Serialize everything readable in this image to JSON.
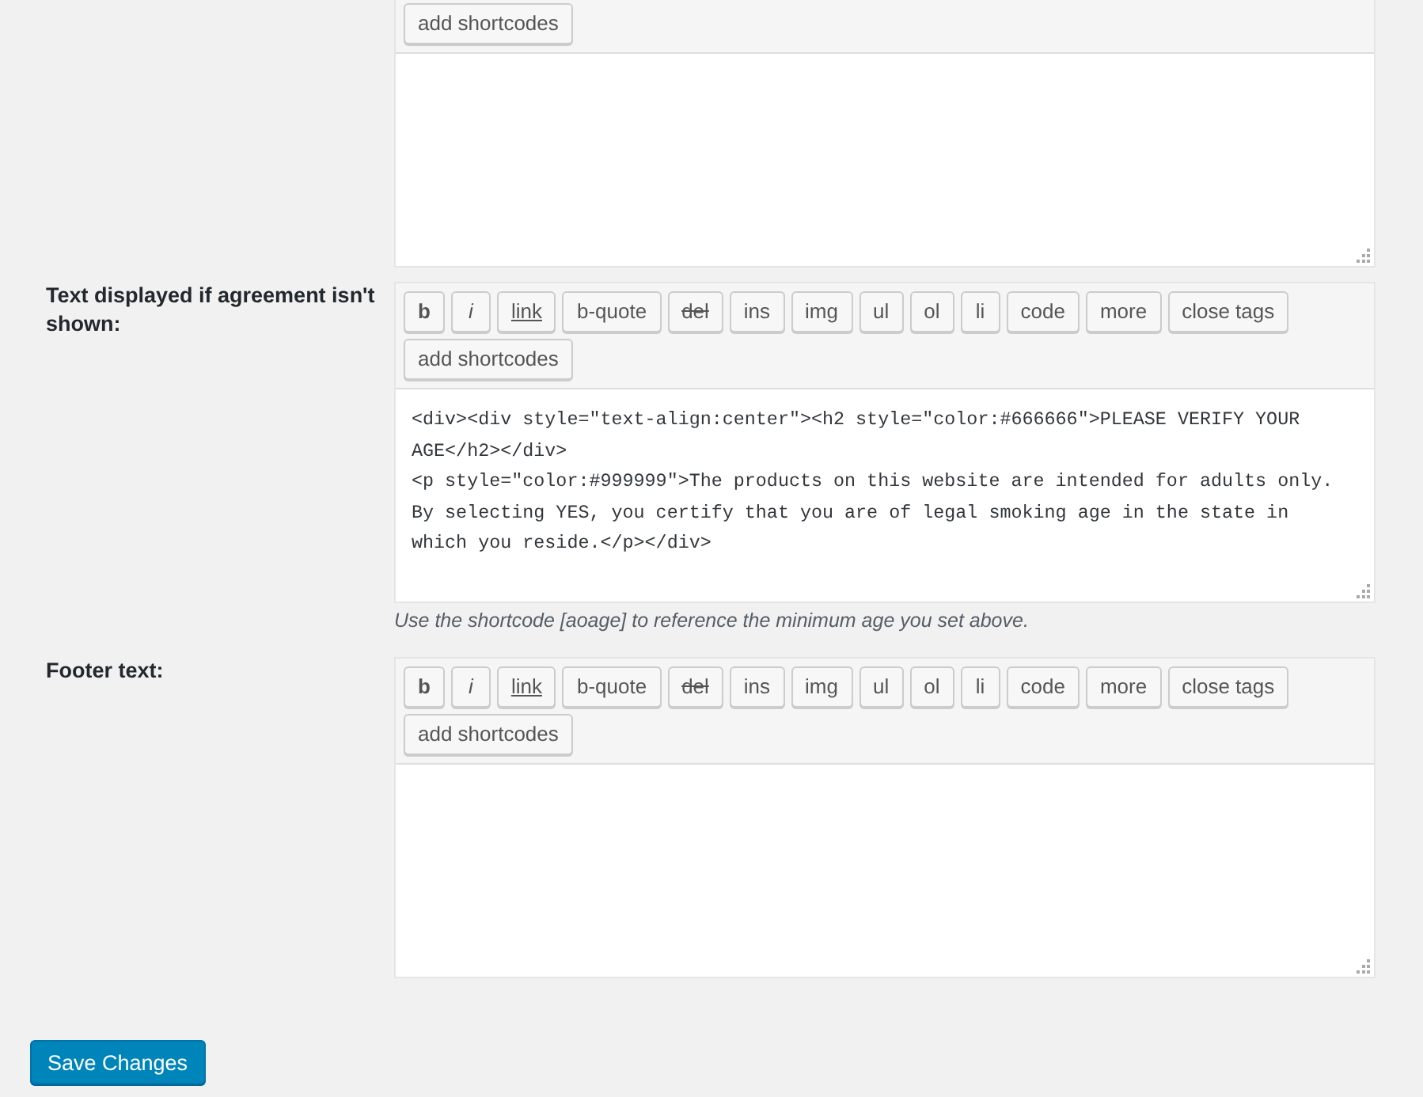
{
  "fields": [
    {
      "buttons": [
        {
          "label": "add shortcodes",
          "kind": "plain"
        }
      ]
    },
    {
      "label": "Text displayed if agreement isn't shown:",
      "buttons": [
        {
          "label": "b",
          "kind": "bold"
        },
        {
          "label": "i",
          "kind": "italic"
        },
        {
          "label": "link",
          "kind": "underline"
        },
        {
          "label": "b-quote",
          "kind": "plain"
        },
        {
          "label": "del",
          "kind": "strike"
        },
        {
          "label": "ins",
          "kind": "plain"
        },
        {
          "label": "img",
          "kind": "plain"
        },
        {
          "label": "ul",
          "kind": "plain"
        },
        {
          "label": "ol",
          "kind": "plain"
        },
        {
          "label": "li",
          "kind": "plain"
        },
        {
          "label": "code",
          "kind": "plain"
        },
        {
          "label": "more",
          "kind": "plain"
        },
        {
          "label": "close tags",
          "kind": "plain"
        },
        {
          "label": "add shortcodes",
          "kind": "plain"
        }
      ],
      "value": "<div><div style=\"text-align:center\"><h2 style=\"color:#666666\">PLEASE VERIFY YOUR AGE</h2></div>\n<p style=\"color:#999999\">The products on this website are intended for adults only. By selecting YES, you certify that you are of legal smoking age in the state in which you reside.</p></div>",
      "hint": "Use the shortcode [aoage] to reference the minimum age you set above."
    },
    {
      "label": "Footer text:",
      "buttons": [
        {
          "label": "b",
          "kind": "bold"
        },
        {
          "label": "i",
          "kind": "italic"
        },
        {
          "label": "link",
          "kind": "underline"
        },
        {
          "label": "b-quote",
          "kind": "plain"
        },
        {
          "label": "del",
          "kind": "strike"
        },
        {
          "label": "ins",
          "kind": "plain"
        },
        {
          "label": "img",
          "kind": "plain"
        },
        {
          "label": "ul",
          "kind": "plain"
        },
        {
          "label": "ol",
          "kind": "plain"
        },
        {
          "label": "li",
          "kind": "plain"
        },
        {
          "label": "code",
          "kind": "plain"
        },
        {
          "label": "more",
          "kind": "plain"
        },
        {
          "label": "close tags",
          "kind": "plain"
        },
        {
          "label": "add shortcodes",
          "kind": "plain"
        }
      ]
    }
  ],
  "submit": {
    "label": "Save Changes"
  }
}
